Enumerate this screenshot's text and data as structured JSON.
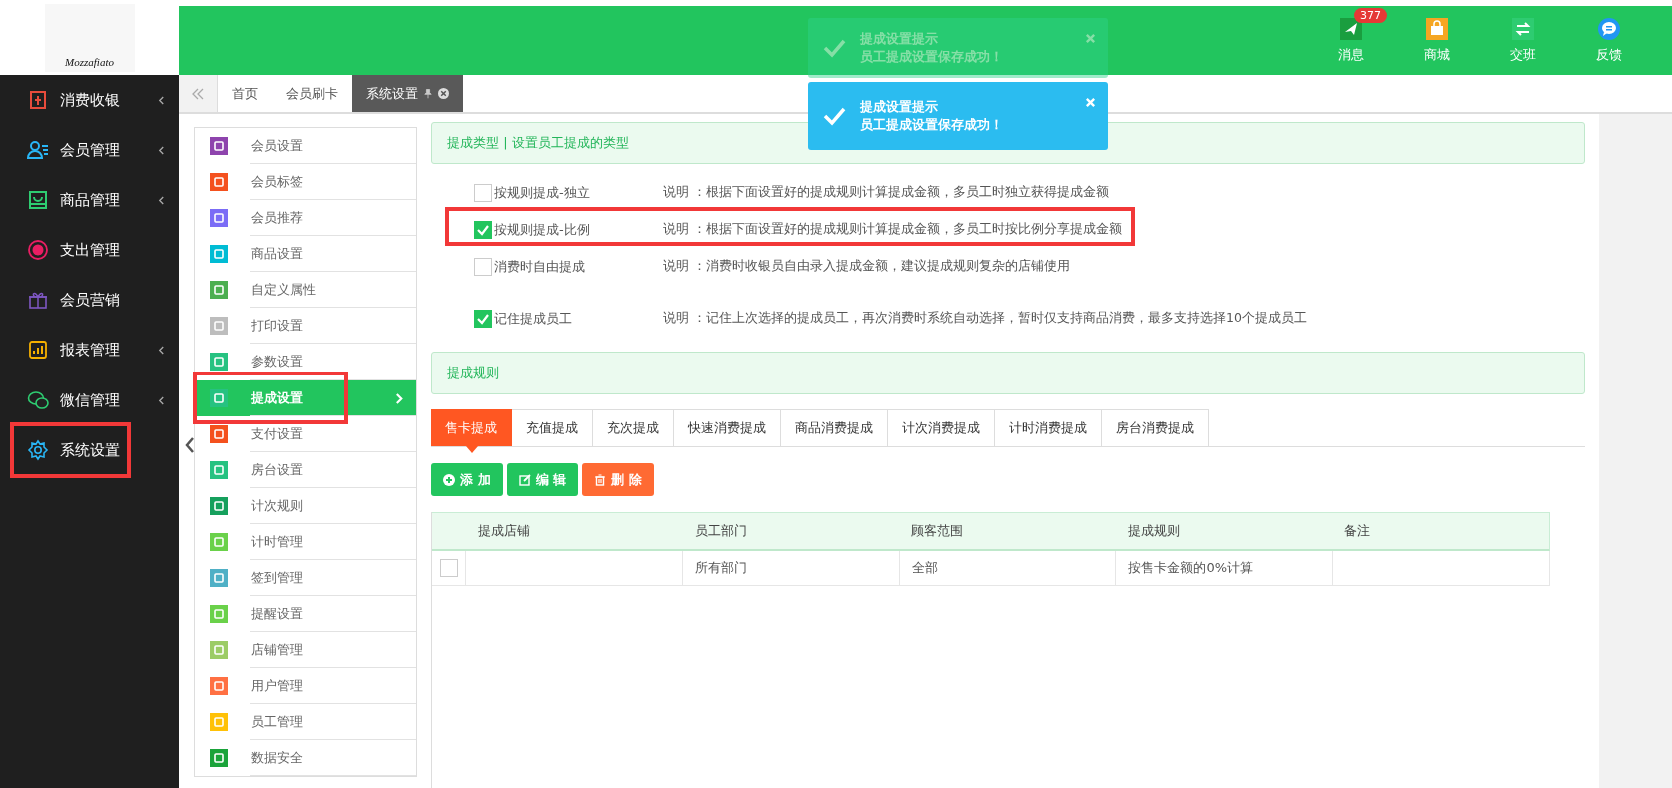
{
  "logo": {
    "text": "Mozzafiato"
  },
  "top_actions": [
    {
      "label": "消息",
      "kind": "send",
      "color": "#1a9e3f",
      "badge": "377"
    },
    {
      "label": "商城",
      "kind": "shop",
      "color": "#f5a623"
    },
    {
      "label": "交班",
      "kind": "swap",
      "color": "#2ecc71"
    },
    {
      "label": "反馈",
      "kind": "chat",
      "color": "#2196f3"
    }
  ],
  "notifications": [
    {
      "title": "提成设置提示",
      "message": "员工提成设置保存成功！",
      "faded": true
    },
    {
      "title": "提成设置提示",
      "message": "员工提成设置保存成功！",
      "faded": false
    }
  ],
  "sidebar": {
    "items": [
      {
        "label": "消费收银",
        "kind": "receipt",
        "color": "#e74c3c",
        "expandable": true
      },
      {
        "label": "会员管理",
        "kind": "person",
        "color": "#29b6f6",
        "expandable": true
      },
      {
        "label": "商品管理",
        "kind": "bag",
        "color": "#2ecc71",
        "expandable": true
      },
      {
        "label": "支出管理",
        "kind": "coin",
        "color": "#e91e63",
        "expandable": false
      },
      {
        "label": "会员营销",
        "kind": "gift",
        "color": "#7e57c2",
        "expandable": false
      },
      {
        "label": "报表管理",
        "kind": "chart",
        "color": "#f5b000",
        "expandable": true
      },
      {
        "label": "微信管理",
        "kind": "wechat",
        "color": "#2ecc71",
        "expandable": true
      },
      {
        "label": "系统设置",
        "kind": "gear",
        "color": "#29b6f6",
        "expandable": false,
        "highlighted": true
      }
    ]
  },
  "page_tabs": [
    {
      "label": "首页",
      "selected": false
    },
    {
      "label": "会员刷卡",
      "selected": false
    },
    {
      "label": "系统设置",
      "selected": true
    }
  ],
  "settings_menu": [
    {
      "label": "会员设置",
      "color": "#8e44ad",
      "selected": false
    },
    {
      "label": "会员标签",
      "color": "#f4511e",
      "selected": false
    },
    {
      "label": "会员推荐",
      "color": "#7b6cf6",
      "selected": false
    },
    {
      "label": "商品设置",
      "color": "#00bcd4",
      "selected": false
    },
    {
      "label": "自定义属性",
      "color": "#4caf50",
      "selected": false
    },
    {
      "label": "打印设置",
      "color": "#bdbdbd",
      "selected": false
    },
    {
      "label": "参数设置",
      "color": "#26c281",
      "selected": false
    },
    {
      "label": "提成设置",
      "color": "#26c281",
      "selected": true,
      "highlighted": true
    },
    {
      "label": "支付设置",
      "color": "#f4511e",
      "selected": false
    },
    {
      "label": "房台设置",
      "color": "#26c281",
      "selected": false
    },
    {
      "label": "计次规则",
      "color": "#16a05d",
      "selected": false
    },
    {
      "label": "计时管理",
      "color": "#6ad14a",
      "selected": false
    },
    {
      "label": "签到管理",
      "color": "#4fb0c6",
      "selected": false
    },
    {
      "label": "提醒设置",
      "color": "#6ad14a",
      "selected": false
    },
    {
      "label": "店铺管理",
      "color": "#9ccc65",
      "selected": false
    },
    {
      "label": "用户管理",
      "color": "#ff7043",
      "selected": false
    },
    {
      "label": "员工管理",
      "color": "#ffc107",
      "selected": false
    },
    {
      "label": "数据安全",
      "color": "#1aa33a",
      "selected": false
    }
  ],
  "type_panel": {
    "title": "提成类型 | 设置员工提成的类型"
  },
  "options": [
    {
      "label": "按规则提成-独立",
      "description": "说明 ：根据下面设置好的提成规则计算提成金额，多员工时独立获得提成金额",
      "checked": false,
      "highlighted": false
    },
    {
      "label": "按规则提成-比例",
      "description": "说明 ：根据下面设置好的提成规则计算提成金额，多员工时按比例分享提成金额",
      "checked": true,
      "highlighted": true
    },
    {
      "label": "消费时自由提成",
      "description": "说明 ：消费时收银员自由录入提成金额，建议提成规则复杂的店铺使用",
      "checked": false,
      "highlighted": false
    },
    {
      "label": "记住提成员工",
      "description": "说明 ：记住上次选择的提成员工，再次消费时系统自动选择，暂时仅支持商品消费，最多支持选择10个提成员工",
      "checked": true,
      "highlighted": false
    }
  ],
  "rule_panel": {
    "title": "提成规则"
  },
  "rule_tabs": [
    {
      "label": "售卡提成",
      "selected": true
    },
    {
      "label": "充值提成",
      "selected": false
    },
    {
      "label": "充次提成",
      "selected": false
    },
    {
      "label": "快速消费提成",
      "selected": false
    },
    {
      "label": "商品消费提成",
      "selected": false
    },
    {
      "label": "计次消费提成",
      "selected": false
    },
    {
      "label": "计时消费提成",
      "selected": false
    },
    {
      "label": "房台消费提成",
      "selected": false
    }
  ],
  "actions": [
    {
      "label": "添 加",
      "kind": "add"
    },
    {
      "label": "编 辑",
      "kind": "edit"
    },
    {
      "label": "删 除",
      "kind": "delete"
    }
  ],
  "table": {
    "columns": [
      "提成店铺",
      "员工部门",
      "顾客范围",
      "提成规则",
      "备注"
    ],
    "rows": [
      {
        "checked": false,
        "cells": [
          "",
          "所有部门",
          "全部",
          "按售卡金额的0%计算",
          ""
        ]
      }
    ]
  }
}
